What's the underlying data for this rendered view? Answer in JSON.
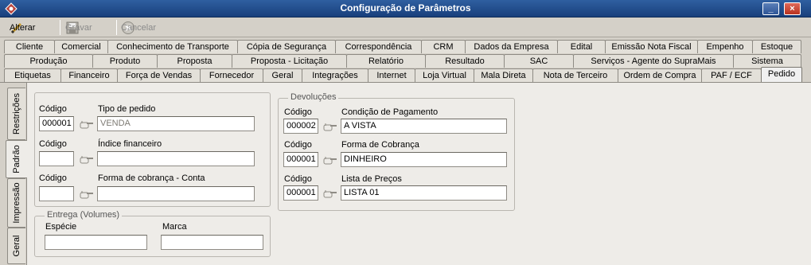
{
  "window": {
    "title": "Configuração de Parâmetros",
    "minimize": "_",
    "close": "×"
  },
  "toolbar": {
    "alterar": "Alterar",
    "gravar": "Gravar",
    "cancelar": "Cancelar"
  },
  "tabs_row1": [
    "Cliente",
    "Comercial",
    "Conhecimento de Transporte",
    "Cópia de Segurança",
    "Correspondência",
    "CRM",
    "Dados da Empresa",
    "Edital",
    "Emissão Nota Fiscal",
    "Empenho",
    "Estoque"
  ],
  "tabs_row2": [
    "Produção",
    "Produto",
    "Proposta",
    "Proposta - Licitação",
    "Relatório",
    "Resultado",
    "SAC",
    "Serviços - Agente do SupraMais",
    "Sistema"
  ],
  "tabs_row3": [
    "Etiquetas",
    "Financeiro",
    "Força de Vendas",
    "Fornecedor",
    "Geral",
    "Integrações",
    "Internet",
    "Loja Virtual",
    "Mala Direta",
    "Nota de Terceiro",
    "Ordem de Compra",
    "PAF / ECF",
    "Pedido"
  ],
  "side_tabs": [
    "Restrições",
    "Padrão",
    "Impressão",
    "Geral"
  ],
  "left": {
    "codigo_label": "Código",
    "tipo_pedido_label": "Tipo de pedido",
    "tipo_pedido_code": "000001",
    "tipo_pedido_value": "VENDA",
    "indice_label": "Índice financeiro",
    "indice_code": "",
    "indice_value": "",
    "forma_conta_label": "Forma de cobrança - Conta",
    "forma_conta_code": "",
    "forma_conta_value": ""
  },
  "entrega": {
    "legend": "Entrega (Volumes)",
    "especie_label": "Espécie",
    "especie_value": "",
    "marca_label": "Marca",
    "marca_value": ""
  },
  "devolucoes": {
    "legend": "Devoluções",
    "codigo_label": "Código",
    "cond_label": "Condição de Pagamento",
    "cond_code": "000002",
    "cond_value": "A VISTA",
    "forma_label": "Forma de Cobrança",
    "forma_code": "000001",
    "forma_value": "DINHEIRO",
    "lista_label": "Lista de Preços",
    "lista_code": "000001",
    "lista_value": "LISTA 01"
  },
  "colors": {
    "titlebar": "#183f7c",
    "panel": "#d4d0c8",
    "content": "#eeece8"
  }
}
